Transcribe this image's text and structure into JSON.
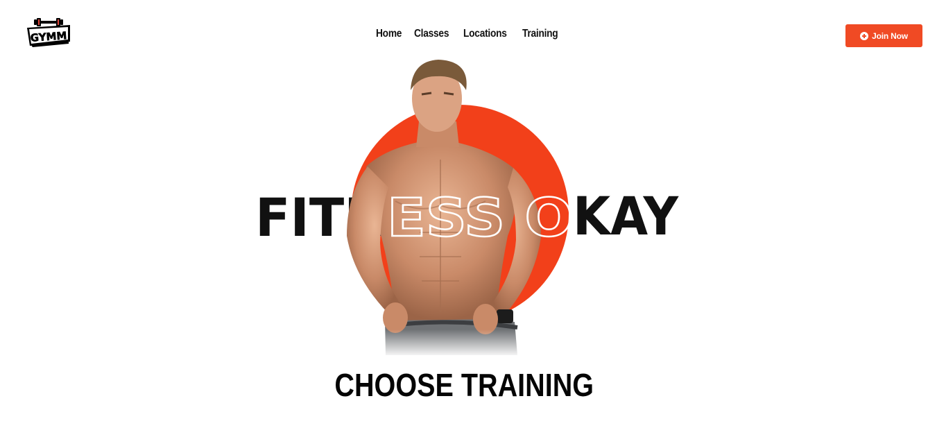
{
  "brand": {
    "logo_text": "GYMM",
    "logo_icon": "dumbbell-icon"
  },
  "nav": {
    "items": [
      {
        "label": "Home"
      },
      {
        "label": "Classes"
      },
      {
        "label": "Locations"
      },
      {
        "label": "Training"
      }
    ]
  },
  "header": {
    "join_label": "Join Now",
    "join_icon": "plus-circle-icon"
  },
  "hero": {
    "headline": "FITNESS OKAY",
    "headline_left": "FITN",
    "headline_middle": "ESS O",
    "headline_right": "KAY",
    "accent_color": "#f04a24"
  },
  "section": {
    "title": "CHOOSE TRAINING"
  },
  "colors": {
    "accent": "#f04a24",
    "text": "#050505",
    "background": "#ffffff"
  }
}
